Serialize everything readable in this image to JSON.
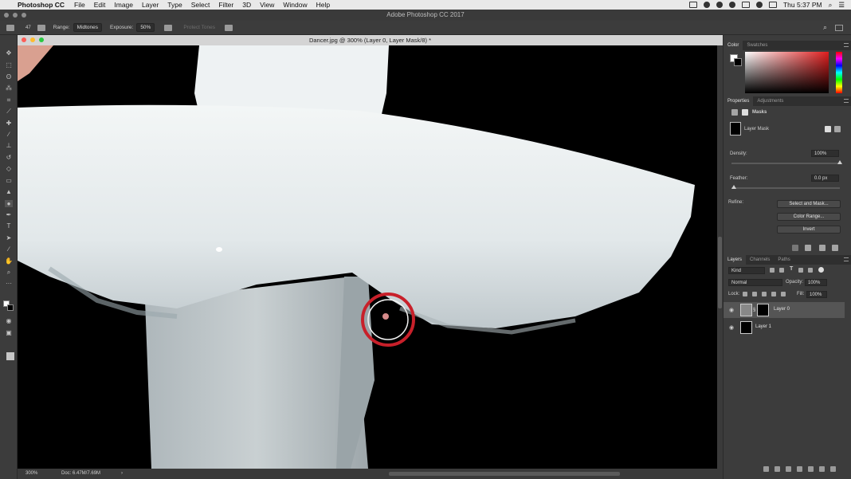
{
  "menubar": {
    "app_name": "Photoshop CC",
    "items": [
      "File",
      "Edit",
      "Image",
      "Layer",
      "Type",
      "Select",
      "Filter",
      "3D",
      "View",
      "Window",
      "Help"
    ],
    "clock": "Thu 5:37 PM"
  },
  "window": {
    "title": "Adobe Photoshop CC 2017"
  },
  "options_bar": {
    "brush_size": "47",
    "range_label": "Range:",
    "range_value": "Midtones",
    "exposure_label": "Exposure:",
    "exposure_value": "50%",
    "protect_tones_label": "Protect Tones"
  },
  "document": {
    "title": "Dancer.jpg @ 300% (Layer 0, Layer Mask/8) *",
    "zoom": "300%",
    "doc_size": "Doc: 6.47M/7.69M"
  },
  "panels": {
    "color_tabs": [
      "Color",
      "Swatches"
    ],
    "properties_tabs": [
      "Properties",
      "Adjustments"
    ],
    "properties": {
      "section_title": "Masks",
      "mask_type": "Layer Mask",
      "density_label": "Density:",
      "density_value": "100%",
      "density_fraction": 1.0,
      "feather_label": "Feather:",
      "feather_value": "0.0 px",
      "feather_fraction": 0.0,
      "refine_label": "Refine:",
      "buttons": [
        "Select and Mask...",
        "Color Range...",
        "Invert"
      ]
    },
    "layers_tabs": [
      "Layers",
      "Channels",
      "Paths"
    ],
    "layers": {
      "filter_label": "Kind",
      "blend_mode": "Normal",
      "opacity_label": "Opacity:",
      "opacity_value": "100%",
      "lock_label": "Lock:",
      "fill_label": "Fill:",
      "fill_value": "100%",
      "items": [
        {
          "name": "Layer 0",
          "selected": true
        },
        {
          "name": "Layer 1",
          "selected": false
        }
      ]
    }
  },
  "colors": {
    "accent_ring": "#c8202a",
    "ui_bg": "#3c3c3c"
  }
}
